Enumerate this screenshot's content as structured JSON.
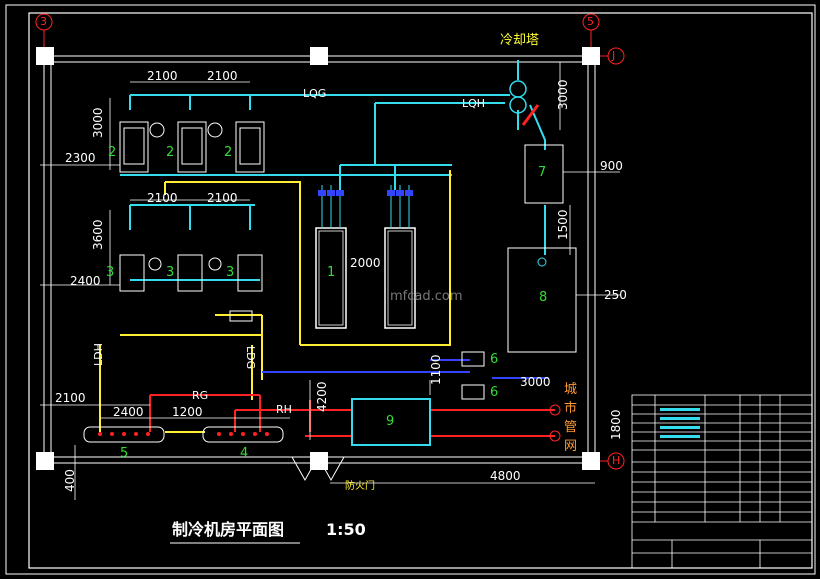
{
  "title": "制冷机房平面图",
  "scale": "1:50",
  "grid_axes": {
    "left": "3",
    "right": "5",
    "top_right": "J",
    "bottom_right": "H"
  },
  "labels": {
    "cooling_tower": "冷却塔",
    "lqg": "LQG",
    "lqh": "LQH",
    "ldg": "LDG",
    "ldh": "LDH",
    "rg": "RG",
    "rh": "RH",
    "city_pipe": [
      "城",
      "市",
      "管",
      "网"
    ],
    "fire_door": "防火门"
  },
  "dimensions": {
    "d2100_a": "2100",
    "d2100_b": "2100",
    "d2100_c": "2100",
    "d2100_d": "2100",
    "d3000_top": "3000",
    "d2300": "2300",
    "d3600": "3600",
    "d2400_left": "2400",
    "d3000_right": "3000",
    "d900": "900",
    "d1500": "1500",
    "d250": "250",
    "d2000": "2000",
    "d4200": "4200",
    "d1100": "1100",
    "d3000_mid": "3000",
    "d2100_bottom": "2100",
    "d2400_bottom": "2400",
    "d1200": "1200",
    "d1800": "1800",
    "d400": "400",
    "d4800": "4800"
  },
  "equipment_numbers": {
    "pump_a": "2",
    "pump_b": "2",
    "pump_c": "2",
    "pump_d": "3",
    "pump_e": "3",
    "pump_f": "3",
    "chiller": "1",
    "equip7": "7",
    "tank8": "8",
    "exch9": "9",
    "unit6a": "6",
    "unit6b": "6",
    "manifold5": "5",
    "manifold4": "4"
  },
  "watermark": "mfcad.com",
  "colors": {
    "cyan": "#33ddee",
    "yellow": "#ffee33",
    "red": "#ff2222",
    "blue": "#3344ff",
    "white": "#ffffff",
    "green": "#33dd33"
  }
}
